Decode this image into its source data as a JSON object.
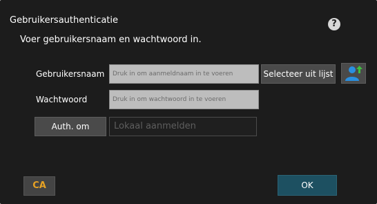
{
  "dialog": {
    "title": "Gebruikersauthenticatie",
    "help_symbol": "?",
    "instruction": "Voer gebruikersnaam en wachtwoord in."
  },
  "form": {
    "username_label": "Gebruikersnaam",
    "username_placeholder": "Druk in om aanmeldnaam in te voeren",
    "select_from_list_label": "Selecteer uit lijst",
    "password_label": "Wachtwoord",
    "password_placeholder": "Druk in om wachtwoord in te voeren",
    "auth_button_label": "Auth. om",
    "auth_destination_value": "Lokaal aanmelden"
  },
  "footer": {
    "ca_label": "CA",
    "ok_label": "OK"
  },
  "colors": {
    "background": "#1c1c1c",
    "ca_text": "#e7a224",
    "ok_button": "#1d5061",
    "user_icon": "#2a8fe0",
    "arrow": "#3fbf3f"
  }
}
